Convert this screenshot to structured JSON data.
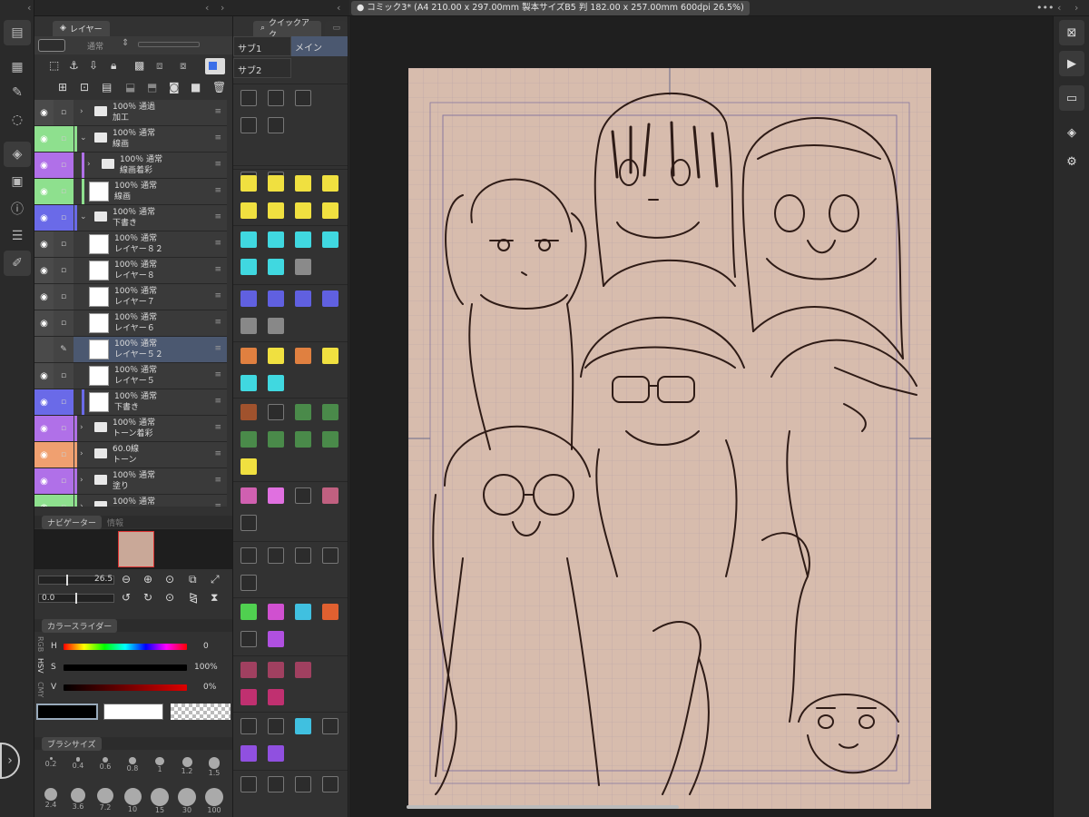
{
  "top": {
    "doc_tab": "● コミック3* (A4 210.00 x 297.00mm 製本サイズB5 判 182.00 x 257.00mm 600dpi 26.5%)",
    "chevrons": [
      "‹",
      "‹",
      "›",
      "‹",
      "›"
    ]
  },
  "layer_panel": {
    "tab": "レイヤー",
    "blend_mode": "通常",
    "rows": [
      {
        "opacity": "100％ 通過",
        "name": "加工",
        "type": "folder",
        "eye": true,
        "color": ""
      },
      {
        "opacity": "100％ 通常",
        "name": "線画",
        "type": "folder",
        "eye": true,
        "color": "#8ee08e"
      },
      {
        "opacity": "100％ 通常",
        "name": "線画着彩",
        "type": "folder",
        "eye": true,
        "color": "#b070e8"
      },
      {
        "opacity": "100％ 通常",
        "name": "線画",
        "type": "layer",
        "eye": true,
        "color": "#8ee08e"
      },
      {
        "opacity": "100％ 通常",
        "name": "下書き",
        "type": "folder",
        "eye": true,
        "color": "#6a6ae8"
      },
      {
        "opacity": "100％ 通常",
        "name": "レイヤー８２",
        "type": "layer",
        "eye": true,
        "color": ""
      },
      {
        "opacity": "100％ 通常",
        "name": "レイヤー８",
        "type": "layer",
        "eye": true,
        "color": ""
      },
      {
        "opacity": "100％ 通常",
        "name": "レイヤー７",
        "type": "layer",
        "eye": true,
        "color": ""
      },
      {
        "opacity": "100％ 通常",
        "name": "レイヤー６",
        "type": "layer",
        "eye": true,
        "color": ""
      },
      {
        "opacity": "100％ 通常",
        "name": "レイヤー５２",
        "type": "layer",
        "eye": false,
        "color": ""
      },
      {
        "opacity": "100％ 通常",
        "name": "レイヤー５",
        "type": "layer",
        "eye": true,
        "color": ""
      },
      {
        "opacity": "100％ 通常",
        "name": "下書き",
        "type": "layer",
        "eye": true,
        "color": "#6a6ae8"
      },
      {
        "opacity": "100％ 通常",
        "name": "トーン着彩",
        "type": "folder",
        "eye": true,
        "color": "#b070e8"
      },
      {
        "opacity": "60.0線",
        "name": "トーン",
        "type": "folder",
        "eye": true,
        "color": "#f0a070"
      },
      {
        "opacity": "100％ 通常",
        "name": "塗り",
        "type": "folder",
        "eye": true,
        "color": "#b070e8"
      },
      {
        "opacity": "100％ 通常",
        "name": "",
        "type": "folder",
        "eye": true,
        "color": "#8ee08e"
      }
    ]
  },
  "navigator": {
    "tab": "ナビゲーター",
    "tab2": "情報",
    "zoom": "26.5",
    "rotation": "0.0"
  },
  "color_slider": {
    "tab": "カラースライダー",
    "modes": [
      "RGB",
      "HSV",
      "CMY"
    ],
    "h_label": "H",
    "h_value": "0",
    "s_label": "S",
    "s_value": "100%",
    "v_label": "V",
    "v_value": "0%"
  },
  "brush_size": {
    "tab": "ブラシサイズ",
    "sizes": [
      "0.2",
      "0.4",
      "0.6",
      "0.8",
      "1",
      "1.2",
      "1.5",
      "2.4",
      "3.6",
      "7.2",
      "10",
      "15",
      "30",
      "100"
    ]
  },
  "quick_access": {
    "tab": "クイックアク",
    "sub1": "サブ1",
    "main": "メイン",
    "sub2": "サブ2"
  },
  "colors": {
    "canvas_bg": "#d7bcad",
    "selected_layer": "#4b5870"
  }
}
